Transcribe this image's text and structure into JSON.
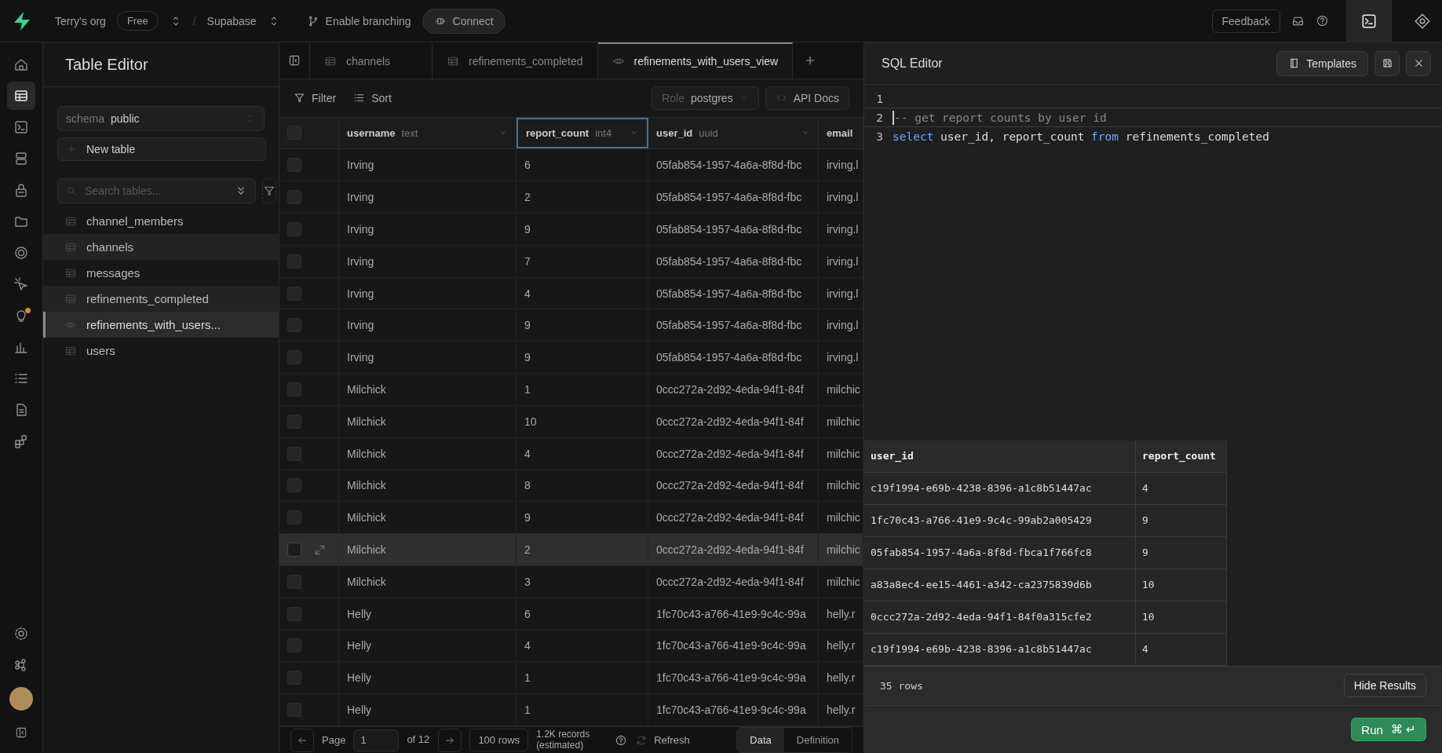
{
  "topbar": {
    "org": "Terry's org",
    "plan": "Free",
    "separator": "/",
    "project": "Supabase",
    "branching": "Enable branching",
    "connect": "Connect",
    "feedback": "Feedback"
  },
  "rail": [
    {
      "kind": "home",
      "selected": false
    },
    {
      "kind": "table",
      "selected": true
    },
    {
      "kind": "terminal",
      "selected": false
    },
    {
      "kind": "database",
      "selected": false
    },
    {
      "kind": "lock",
      "selected": false
    },
    {
      "kind": "folder",
      "selected": false
    },
    {
      "kind": "globe",
      "selected": false
    },
    {
      "kind": "cursor",
      "selected": false
    },
    {
      "kind": "bulb",
      "selected": false
    },
    {
      "kind": "chart",
      "selected": false
    },
    {
      "kind": "list",
      "selected": false
    },
    {
      "kind": "document",
      "selected": false
    },
    {
      "kind": "blocks",
      "selected": false
    }
  ],
  "sidebar": {
    "title": "Table Editor",
    "schema_label": "schema",
    "schema": "public",
    "new_table": "New table",
    "search_placeholder": "Search tables...",
    "items": [
      {
        "kind": "table",
        "label": "channel_members",
        "open": false,
        "selected": false
      },
      {
        "kind": "table",
        "label": "channels",
        "open": true,
        "selected": false
      },
      {
        "kind": "table",
        "label": "messages",
        "open": false,
        "selected": false
      },
      {
        "kind": "table",
        "label": "refinements_completed",
        "open": true,
        "selected": false
      },
      {
        "kind": "view",
        "label": "refinements_with_users...",
        "open": true,
        "selected": true
      },
      {
        "kind": "table",
        "label": "users",
        "open": false,
        "selected": false
      }
    ]
  },
  "tabs": [
    {
      "kind": "table",
      "label": "channels",
      "selected": false
    },
    {
      "kind": "table",
      "label": "refinements_completed",
      "selected": false
    },
    {
      "kind": "view",
      "label": "refinements_with_users_view",
      "selected": true
    }
  ],
  "toolbar": {
    "filter": "Filter",
    "sort": "Sort",
    "role_label": "Role",
    "role": "postgres",
    "api_docs": "API Docs"
  },
  "table": {
    "select_all_checked": false,
    "columns": [
      {
        "name": "username",
        "type": "text",
        "selected": false
      },
      {
        "name": "report_count",
        "type": "int4",
        "selected": true
      },
      {
        "name": "user_id",
        "type": "uuid",
        "selected": false
      },
      {
        "name": "email",
        "selected": false
      }
    ],
    "rows": [
      {
        "checked": false,
        "highlighted": false,
        "cells": [
          "Irving",
          "6",
          "05fab854-1957-4a6a-8f8d-fbc",
          "irving.l"
        ]
      },
      {
        "checked": false,
        "highlighted": false,
        "cells": [
          "Irving",
          "2",
          "05fab854-1957-4a6a-8f8d-fbc",
          "irving.l"
        ]
      },
      {
        "checked": false,
        "highlighted": false,
        "cells": [
          "Irving",
          "9",
          "05fab854-1957-4a6a-8f8d-fbc",
          "irving.l"
        ]
      },
      {
        "checked": false,
        "highlighted": false,
        "cells": [
          "Irving",
          "7",
          "05fab854-1957-4a6a-8f8d-fbc",
          "irving.l"
        ]
      },
      {
        "checked": false,
        "highlighted": false,
        "cells": [
          "Irving",
          "4",
          "05fab854-1957-4a6a-8f8d-fbc",
          "irving.l"
        ]
      },
      {
        "checked": false,
        "highlighted": false,
        "cells": [
          "Irving",
          "9",
          "05fab854-1957-4a6a-8f8d-fbc",
          "irving.l"
        ]
      },
      {
        "checked": false,
        "highlighted": false,
        "cells": [
          "Irving",
          "9",
          "05fab854-1957-4a6a-8f8d-fbc",
          "irving.l"
        ]
      },
      {
        "checked": false,
        "highlighted": false,
        "cells": [
          "Milchick",
          "1",
          "0ccc272a-2d92-4eda-94f1-84f",
          "milchic"
        ]
      },
      {
        "checked": false,
        "highlighted": false,
        "cells": [
          "Milchick",
          "10",
          "0ccc272a-2d92-4eda-94f1-84f",
          "milchic"
        ]
      },
      {
        "checked": false,
        "highlighted": false,
        "cells": [
          "Milchick",
          "4",
          "0ccc272a-2d92-4eda-94f1-84f",
          "milchic"
        ]
      },
      {
        "checked": false,
        "highlighted": false,
        "cells": [
          "Milchick",
          "8",
          "0ccc272a-2d92-4eda-94f1-84f",
          "milchic"
        ]
      },
      {
        "checked": false,
        "highlighted": false,
        "cells": [
          "Milchick",
          "9",
          "0ccc272a-2d92-4eda-94f1-84f",
          "milchic"
        ]
      },
      {
        "checked": false,
        "highlighted": true,
        "cells": [
          "Milchick",
          "2",
          "0ccc272a-2d92-4eda-94f1-84f",
          "milchic"
        ]
      },
      {
        "checked": false,
        "highlighted": false,
        "cells": [
          "Milchick",
          "3",
          "0ccc272a-2d92-4eda-94f1-84f",
          "milchic"
        ]
      },
      {
        "checked": false,
        "highlighted": false,
        "cells": [
          "Helly",
          "6",
          "1fc70c43-a766-41e9-9c4c-99a",
          "helly.r"
        ]
      },
      {
        "checked": false,
        "highlighted": false,
        "cells": [
          "Helly",
          "4",
          "1fc70c43-a766-41e9-9c4c-99a",
          "helly.r"
        ]
      },
      {
        "checked": false,
        "highlighted": false,
        "cells": [
          "Helly",
          "1",
          "1fc70c43-a766-41e9-9c4c-99a",
          "helly.r"
        ]
      },
      {
        "checked": false,
        "highlighted": false,
        "cells": [
          "Helly",
          "1",
          "1fc70c43-a766-41e9-9c4c-99a",
          "helly.r"
        ]
      }
    ]
  },
  "pager": {
    "page_label": "Page",
    "page": "1",
    "of": "of 12",
    "rows": "100 rows",
    "records": "1.2K records (estimated)",
    "refresh": "Refresh",
    "views": [
      {
        "label": "Data",
        "selected": true
      },
      {
        "label": "Definition",
        "selected": false
      }
    ]
  },
  "sql_editor": {
    "title": "SQL Editor",
    "templates": "Templates",
    "lines": [
      {
        "number": "1",
        "active": false
      },
      {
        "number": "2",
        "active": true,
        "tokens": [
          {
            "kind": "comment",
            "text": "-- get report counts by user id"
          }
        ]
      },
      {
        "number": "3",
        "active": false,
        "tokens": [
          {
            "kind": "keyword",
            "text": "select"
          },
          {
            "kind": "plain",
            "text": "user_id, report_count"
          },
          {
            "kind": "keyword",
            "text": "from"
          },
          {
            "kind": "plain",
            "text": "refinements_completed"
          }
        ]
      }
    ],
    "results": {
      "columns": [
        "user_id",
        "report_count"
      ],
      "rows": [
        [
          "c19f1994-e69b-4238-8396-a1c8b51447ac",
          "4"
        ],
        [
          "1fc70c43-a766-41e9-9c4c-99ab2a005429",
          "9"
        ],
        [
          "05fab854-1957-4a6a-8f8d-fbca1f766fc8",
          "9"
        ],
        [
          "a83a8ec4-ee15-4461-a342-ca2375839d6b",
          "10"
        ],
        [
          "0ccc272a-2d92-4eda-94f1-84f0a315cfe2",
          "10"
        ],
        [
          "c19f1994-e69b-4238-8396-a1c8b51447ac",
          "4"
        ]
      ],
      "count": "35 rows",
      "hide": "Hide Results"
    },
    "run": {
      "label": "Run",
      "shortcut": "⌘ ↵"
    }
  }
}
